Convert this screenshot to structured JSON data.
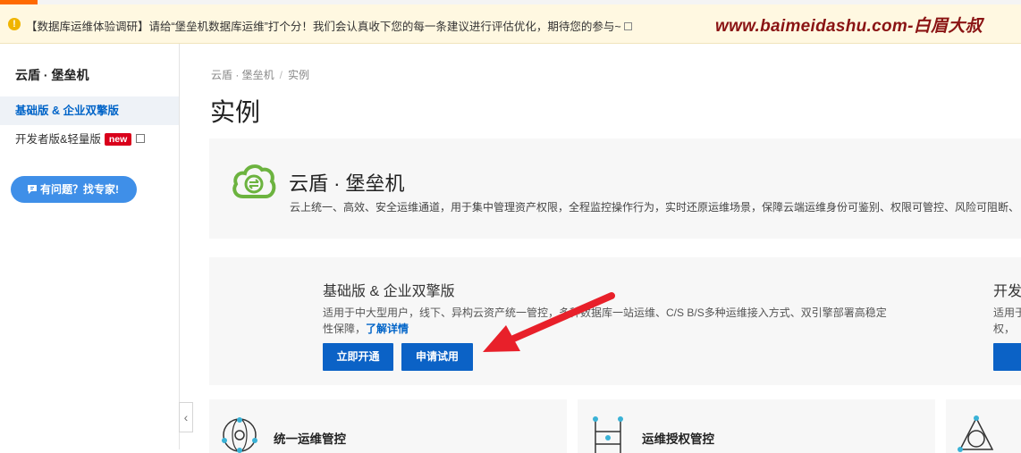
{
  "banner": {
    "message": "【数据库运维体验调研】请给“堡垒机数据库运维”打个分！我们会认真收下您的每一条建议进行评估优化，期待您的参与~",
    "watermark": "www.baimeidashu.com-白眉大叔"
  },
  "sidebar": {
    "title": "云盾 · 堡垒机",
    "items": [
      {
        "label": "基础版 & 企业双擎版"
      },
      {
        "label": "开发者版&轻量版",
        "badge": "new"
      }
    ],
    "expert_button": "有问题？找专家!"
  },
  "breadcrumb": [
    "云盾 · 堡垒机",
    "实例"
  ],
  "page_title": "实例",
  "product": {
    "name": "云盾 · 堡垒机",
    "description": "云上统一、高效、安全运维通道，用于集中管理资产权限，全程监控操作行为，实时还原运维场景，保障云端运维身份可鉴别、权限可管控、风险可阻断、"
  },
  "editions": [
    {
      "title": "基础版 & 企业双擎版",
      "description_line1": "适用于中大型用户，线下、异构云资产统一管控，",
      "description_hidden": "多种数据库一站运维、C/S B/S多种运维接入方式、双引擎部署高稳定",
      "description_line2": "性保障，",
      "link": "了解详情",
      "buttons": [
        "立即开通",
        "申请试用"
      ]
    },
    {
      "title": "开发",
      "description_line1": "适用于",
      "description_line2": "权，",
      "buttons": [
        ""
      ]
    }
  ],
  "features": [
    {
      "label": "统一运维管控",
      "icon": "unified-ops-icon"
    },
    {
      "label": "运维授权管控",
      "icon": "authorization-icon"
    },
    {
      "label": "",
      "icon": "risk-icon"
    }
  ],
  "colors": {
    "primary": "#0b62c6",
    "accent": "#ff6a00",
    "banner_bg": "#fff8e1",
    "watermark": "#8a1414",
    "arrow": "#e8202a",
    "logo": "#6cb33f"
  }
}
